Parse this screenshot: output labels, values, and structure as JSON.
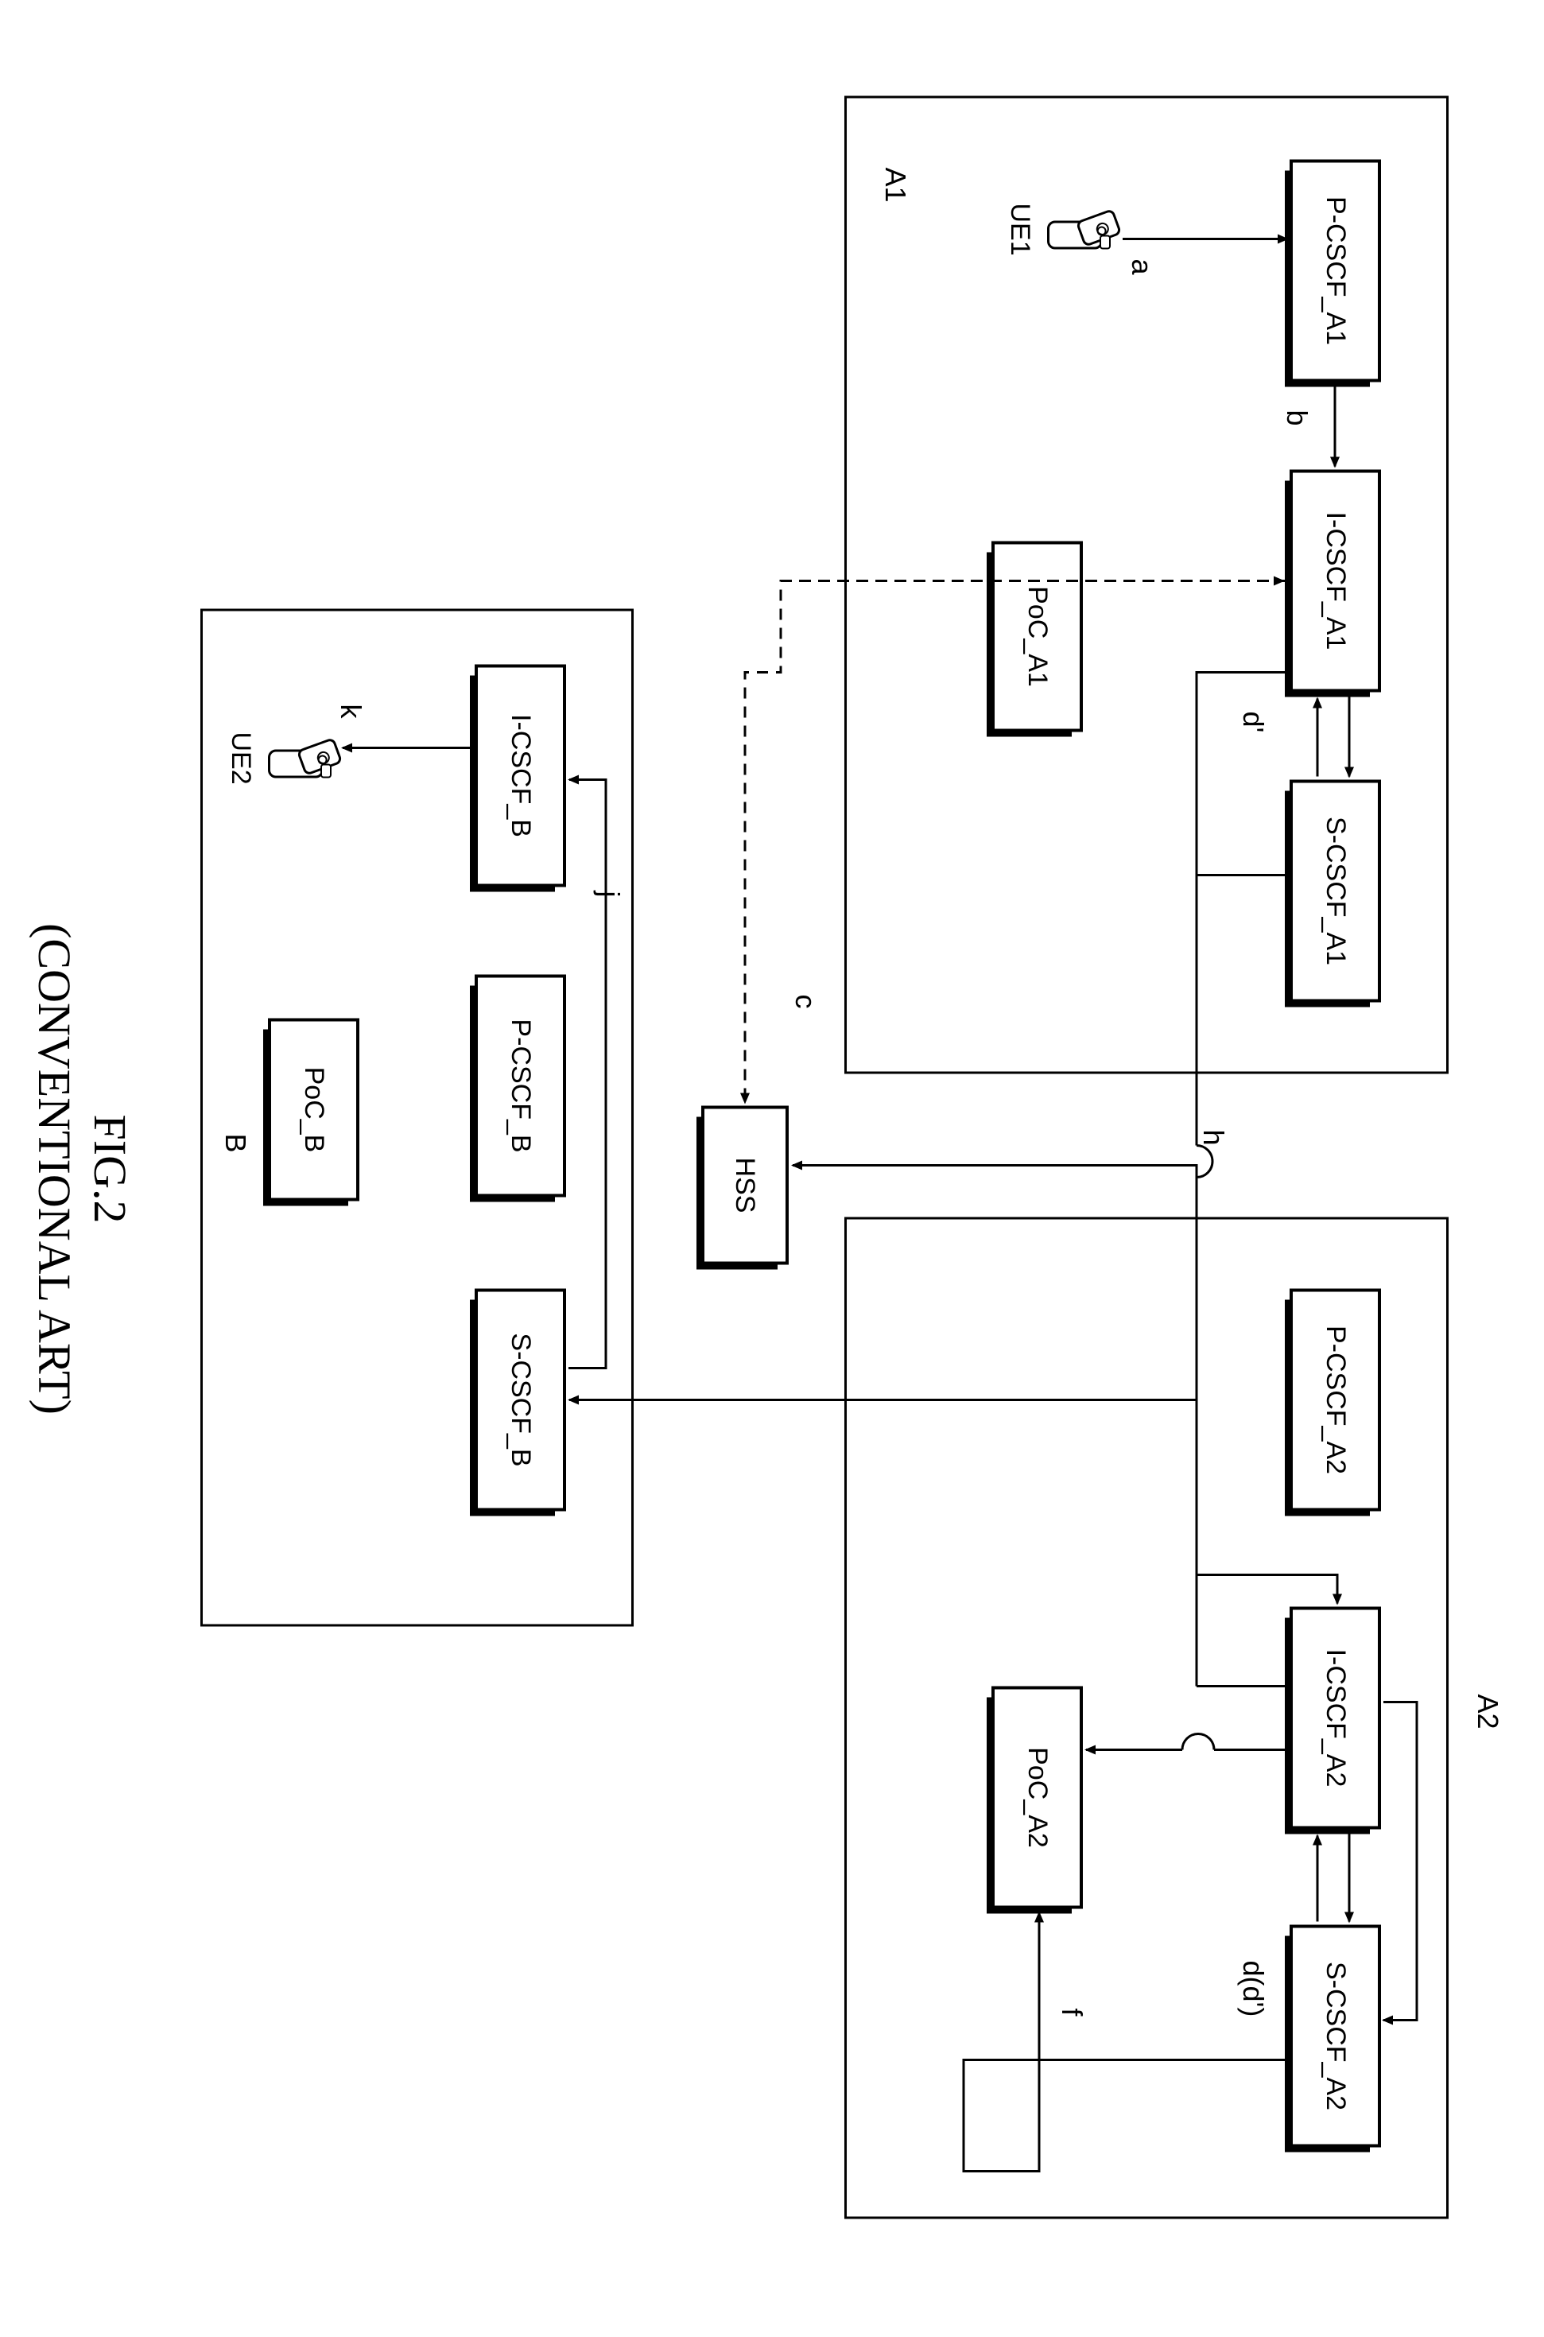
{
  "figure": {
    "number": "FIG.2",
    "subtitle": "(CONVENTIONAL ART)"
  },
  "regions": {
    "a1": {
      "label": "A1"
    },
    "a2": {
      "label": "A2"
    },
    "b": {
      "label": "B"
    }
  },
  "blocks": {
    "p_cscf_a1": "P-CSCF_A1",
    "i_cscf_a1": "I-CSCF_A1",
    "s_cscf_a1": "S-CSCF_A1",
    "poc_a1": "PoC_A1",
    "p_cscf_a2": "P-CSCF_A2",
    "i_cscf_a2": "I-CSCF_A2",
    "s_cscf_a2": "S-CSCF_A2",
    "poc_a2": "PoC_A2",
    "p_cscf_b": "P-CSCF_B",
    "i_cscf_b": "I-CSCF_B",
    "s_cscf_b": "S-CSCF_B",
    "poc_b": "PoC_B",
    "hss": "HSS"
  },
  "devices": {
    "ue1": "UE1",
    "ue2": "UE2"
  },
  "edges": {
    "a": "a",
    "b": "b",
    "c": "c",
    "d_prime_a1": "d'",
    "d_a2": "d(d')",
    "f": "f",
    "h": "h",
    "j": "j",
    "k": "k"
  }
}
